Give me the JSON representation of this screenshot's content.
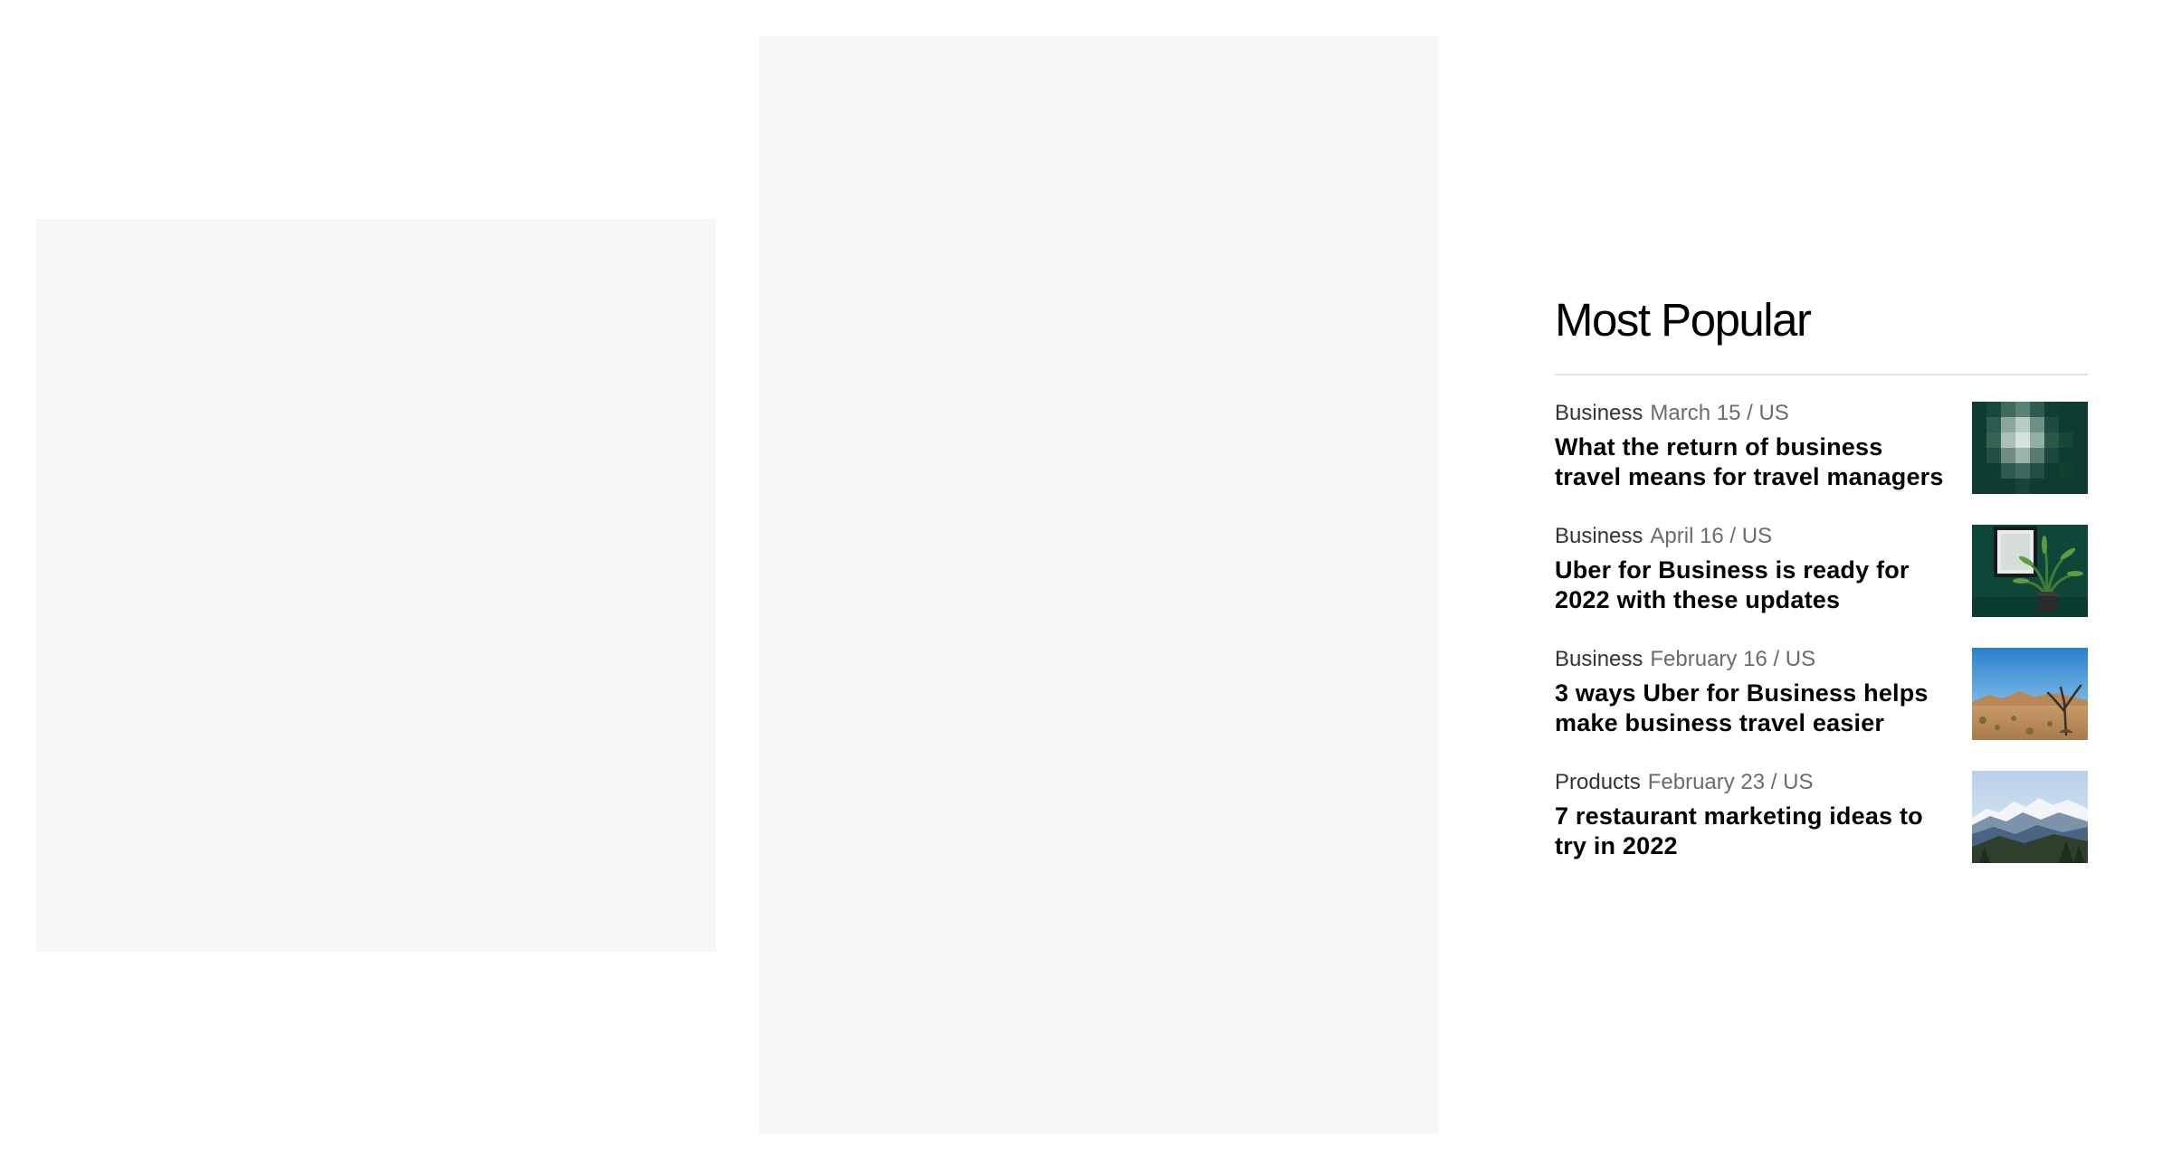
{
  "popular": {
    "title": "Most Popular",
    "articles": [
      {
        "category": "Business",
        "date": "March 15 / US",
        "headline": "What the return of business travel means for travel managers",
        "thumbnail": "green-abstract-image"
      },
      {
        "category": "Business",
        "date": "April 16 / US",
        "headline": "Uber for Business is ready for 2022 with these updates",
        "thumbnail": "potted-plant-green-wall-image"
      },
      {
        "category": "Business",
        "date": "February 16 / US",
        "headline": "3 ways Uber for Business helps make business travel easier",
        "thumbnail": "desert-landscape-image"
      },
      {
        "category": "Products",
        "date": "February 23 / US",
        "headline": "7 restaurant marketing ideas to try in 2022",
        "thumbnail": "snowy-mountains-image"
      }
    ]
  },
  "colors": {
    "placeholder": "#f6f6f6",
    "divider": "#e2e2e2",
    "text_primary": "#000000",
    "text_secondary": "#6b6b6b"
  }
}
